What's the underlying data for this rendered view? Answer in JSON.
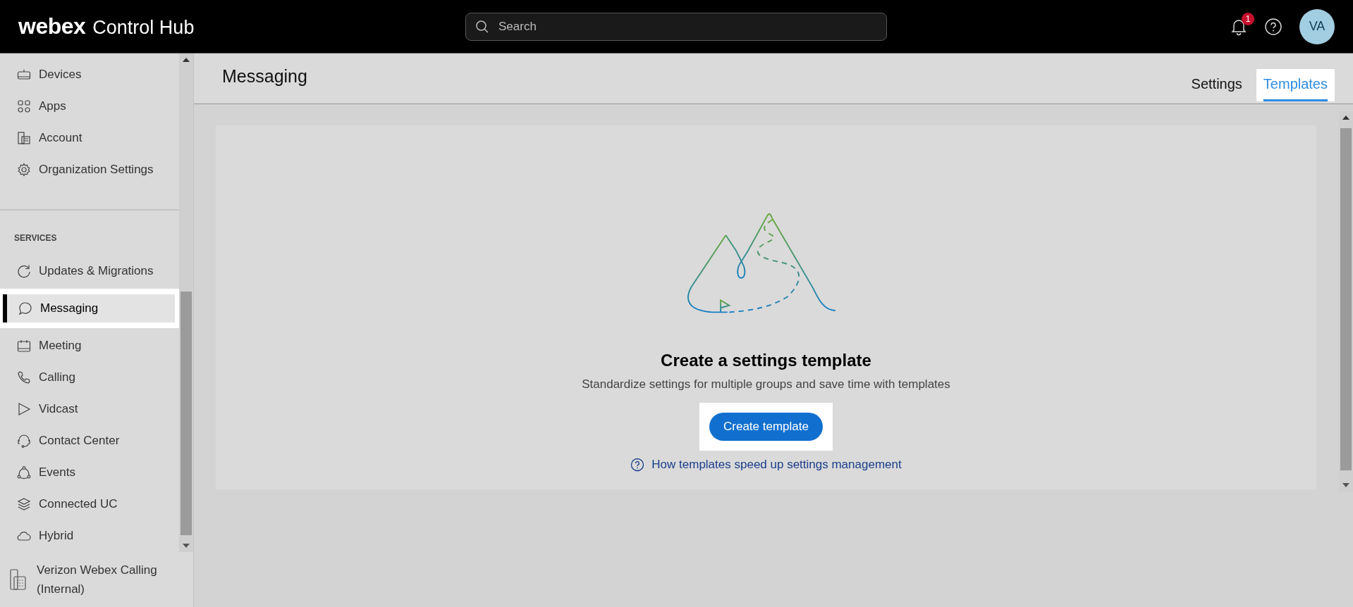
{
  "header": {
    "logo": "webex",
    "product": "Control Hub",
    "search": {
      "placeholder": "Search"
    },
    "notification_count": "1",
    "avatar": "VA"
  },
  "sidebar": {
    "items": [
      {
        "label": "Devices",
        "selected": false,
        "highlighted": false
      },
      {
        "label": "Apps",
        "selected": false,
        "highlighted": false
      },
      {
        "label": "Account",
        "selected": false,
        "highlighted": false
      },
      {
        "label": "Organization Settings",
        "selected": false,
        "highlighted": false
      }
    ],
    "section": {
      "heading": "SERVICES",
      "items": [
        {
          "label": "Updates & Migrations",
          "selected": false,
          "highlighted": false
        },
        {
          "label": "Messaging",
          "selected": true,
          "highlighted": true
        },
        {
          "label": "Meeting",
          "selected": false,
          "highlighted": false
        },
        {
          "label": "Calling",
          "selected": false,
          "highlighted": false
        },
        {
          "label": "Vidcast",
          "selected": false,
          "highlighted": false
        },
        {
          "label": "Contact Center",
          "selected": false,
          "highlighted": false
        },
        {
          "label": "Events",
          "selected": false,
          "highlighted": false
        },
        {
          "label": "Connected UC",
          "selected": false,
          "highlighted": false
        },
        {
          "label": "Hybrid",
          "selected": false,
          "highlighted": false
        }
      ]
    },
    "organization": "Verizon Webex Calling (Internal)"
  },
  "page": {
    "title": "Messaging",
    "tabs": [
      {
        "label": "Settings",
        "selected": false,
        "highlighted": false
      },
      {
        "label": "Templates",
        "selected": true,
        "highlighted": true
      }
    ]
  },
  "empty_state": {
    "title": "Create a settings template",
    "description": "Standardize settings for multiple groups and save time with templates",
    "button": {
      "label": "Create template",
      "highlighted": true
    },
    "help_link": "How templates speed up settings management"
  }
}
